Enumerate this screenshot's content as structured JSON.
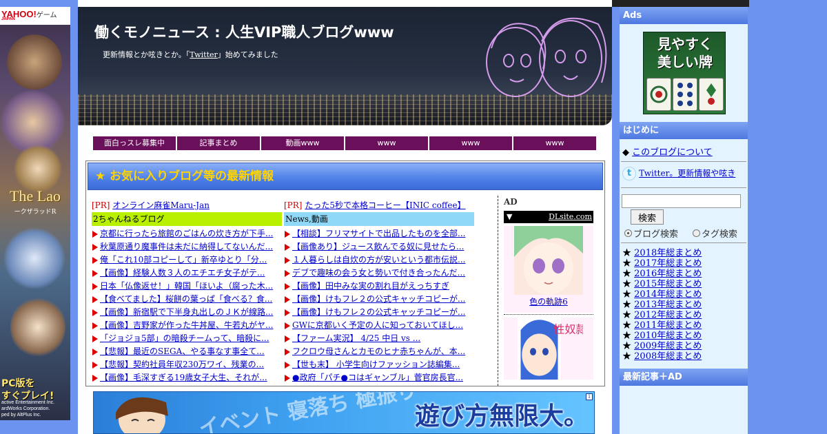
{
  "left_ad": {
    "brand": "YAHOO!",
    "brand_sub": "JAPAN",
    "brand_game": "ゲーム",
    "logo": "The Lao",
    "logo_sub": "ークザラッドR",
    "pc_line1": "PC版を",
    "pc_line2": "すぐプレイ!",
    "copyright": [
      "active Entertainment Inc.",
      "ardWorks Corporation.",
      "ped by AltPlus Inc."
    ]
  },
  "header": {
    "title": "働くモノニュース : 人生VIP職人ブログwww",
    "subtitle_pre": "更新情報とか呟きとか。「",
    "subtitle_link": "Twitter",
    "subtitle_post": "」始めてみました"
  },
  "nav": [
    "面白っスレ募集中",
    "記事まとめ",
    "動画www",
    "www",
    "www",
    "www"
  ],
  "favorites": {
    "heading": "★ お気に入りブログ等の最新情報",
    "col1": {
      "pr_tag": "[PR]",
      "pr_link": "オンライン麻雀Maru-Jan",
      "category": "2ちゃんねるブログ",
      "items": [
        "京都に行ったら旅館のごはんの炊き方が下手...",
        "秋葉原通り魔事件は未だに納得してないんだ...",
        "俺「これ10部コピーして」新卒ゆとり「分...",
        "【画像】経験人数３人のエチエチ女子がテ...",
        "日本「仏像返せ！」韓国「ほいよ（腐った木...",
        "【食べてました】桜餅の葉っぱ「食べる？食...",
        "【画像】新宿駅で下半身丸出しのＪＫが線路...",
        "【画像】吉野家が作った牛丼屋、牛若丸がヤ...",
        "「ジョジョ5部」の暗殺チームって、暗殺に...",
        "【悲報】最近のSEGA、やる事なす事全て...",
        "【悲報】契約社員年収230万ワイ、残業の...",
        "【画像】毛深すぎる19歳女子大生、それが..."
      ]
    },
    "col2": {
      "pr_tag": "[PR]",
      "pr_link": "たった5秒で本格コーヒー【INIC coffee】",
      "category": "News,動画",
      "items": [
        "【相談】フリマサイトで出品したものを全部...",
        "【画像あり】ジュース飲んでる奴に見せたら...",
        "１人暮らしは自炊の方が安いという都市伝説...",
        "デブで趣味の会う女と勢いで付き合ったんだ...",
        "【画像】田中みな実の割れ目がえっちすぎ",
        "【画像】けもフレ２の公式キャッチコピーが...",
        "【画像】けもフレ２の公式キャッチコピーが...",
        "GWに京都いく予定の人に知っておいてほし...",
        "【ファーム実況】 4/25 中日 vs ...",
        "フクロウ母さんとカモのヒナ赤ちゃんが、本...",
        "【世も末】 小学生向けファッション誌編集...",
        "●政府「パチ●コはギャンブル」菅官房長官..."
      ]
    },
    "ad_col": {
      "label": "AD",
      "bar_arrow": "▼",
      "bar_link": "DLsite.com",
      "item1_caption": "色の軌跡6",
      "item2_text": "性奴隷"
    }
  },
  "banner": {
    "slogan": "遊び方無限大。",
    "bg_text": "イベント 寝落ち 極振り",
    "info": "i"
  },
  "sidebar": {
    "ads_heading": "Ads",
    "mahjong_line1": "見やすく",
    "mahjong_line2": "美しい牌",
    "intro_heading": "はじめに",
    "about_bullet": "◆",
    "about_link": "このブログについて",
    "twitter_icon_glyph": "t",
    "twitter_link": "Twitter。更新情報や呟き",
    "search_button": "検索",
    "radio_blog": "ブログ検索",
    "radio_tag": "タグ検索",
    "archive_star": "★",
    "archive": [
      "2018年総まとめ",
      "2017年総まとめ",
      "2016年総まとめ",
      "2015年総まとめ",
      "2014年総まとめ",
      "2013年総まとめ",
      "2012年総まとめ",
      "2011年総まとめ",
      "2010年総まとめ",
      "2009年総まとめ",
      "2008年総まとめ"
    ],
    "recent_heading": "最新記事＋AD"
  }
}
